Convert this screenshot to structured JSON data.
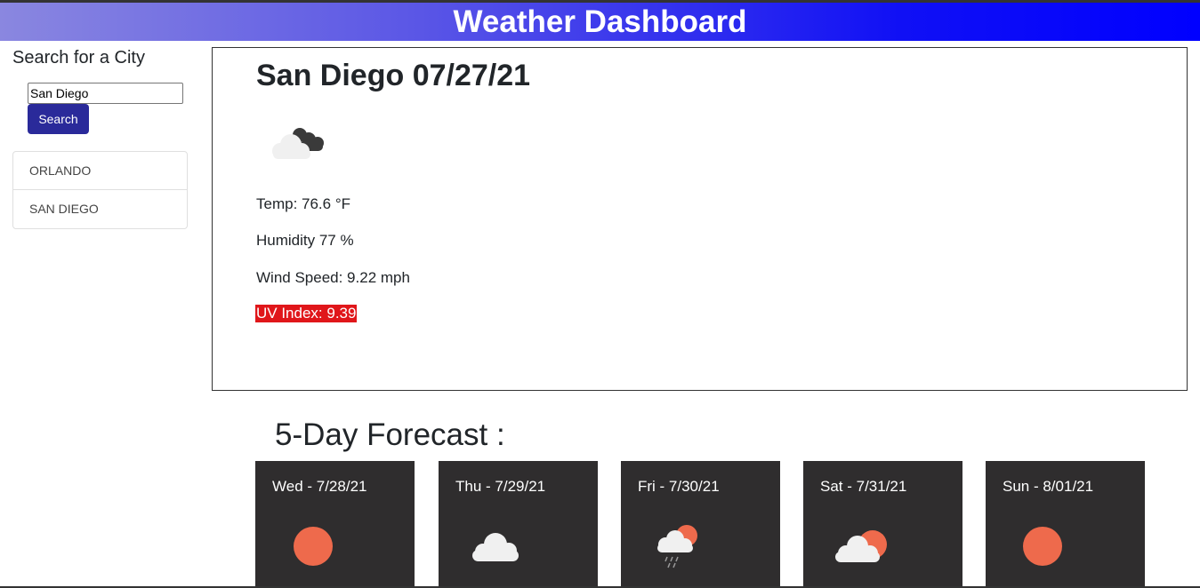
{
  "header": {
    "title": "Weather Dashboard"
  },
  "sidebar": {
    "title": "Search for a City",
    "search_value": "San Diego",
    "search_button": "Search",
    "history": [
      "ORLANDO",
      "SAN DIEGO"
    ]
  },
  "current": {
    "city_date": "San Diego 07/27/21",
    "icon": "broken-clouds-icon",
    "temp": "Temp: 76.6 °F",
    "humidity": "Humidity 77 %",
    "wind": "Wind Speed: 9.22 mph",
    "uv": "UV Index: 9.39",
    "uv_color": "#e0161a"
  },
  "forecast": {
    "title": "5-Day Forecast :",
    "days": [
      {
        "date": "Wed - 7/28/21",
        "icon": "sun-icon"
      },
      {
        "date": "Thu - 7/29/21",
        "icon": "cloud-icon"
      },
      {
        "date": "Fri - 7/30/21",
        "icon": "rain-sun-icon"
      },
      {
        "date": "Sat - 7/31/21",
        "icon": "partly-cloudy-icon"
      },
      {
        "date": "Sun - 8/01/21",
        "icon": "sun-icon"
      }
    ]
  },
  "colors": {
    "header_start": "#8a87e0",
    "header_end": "#0000ff",
    "button": "#2a2a9a",
    "card": "#2f2d2e",
    "sun": "#ee6a4c"
  }
}
